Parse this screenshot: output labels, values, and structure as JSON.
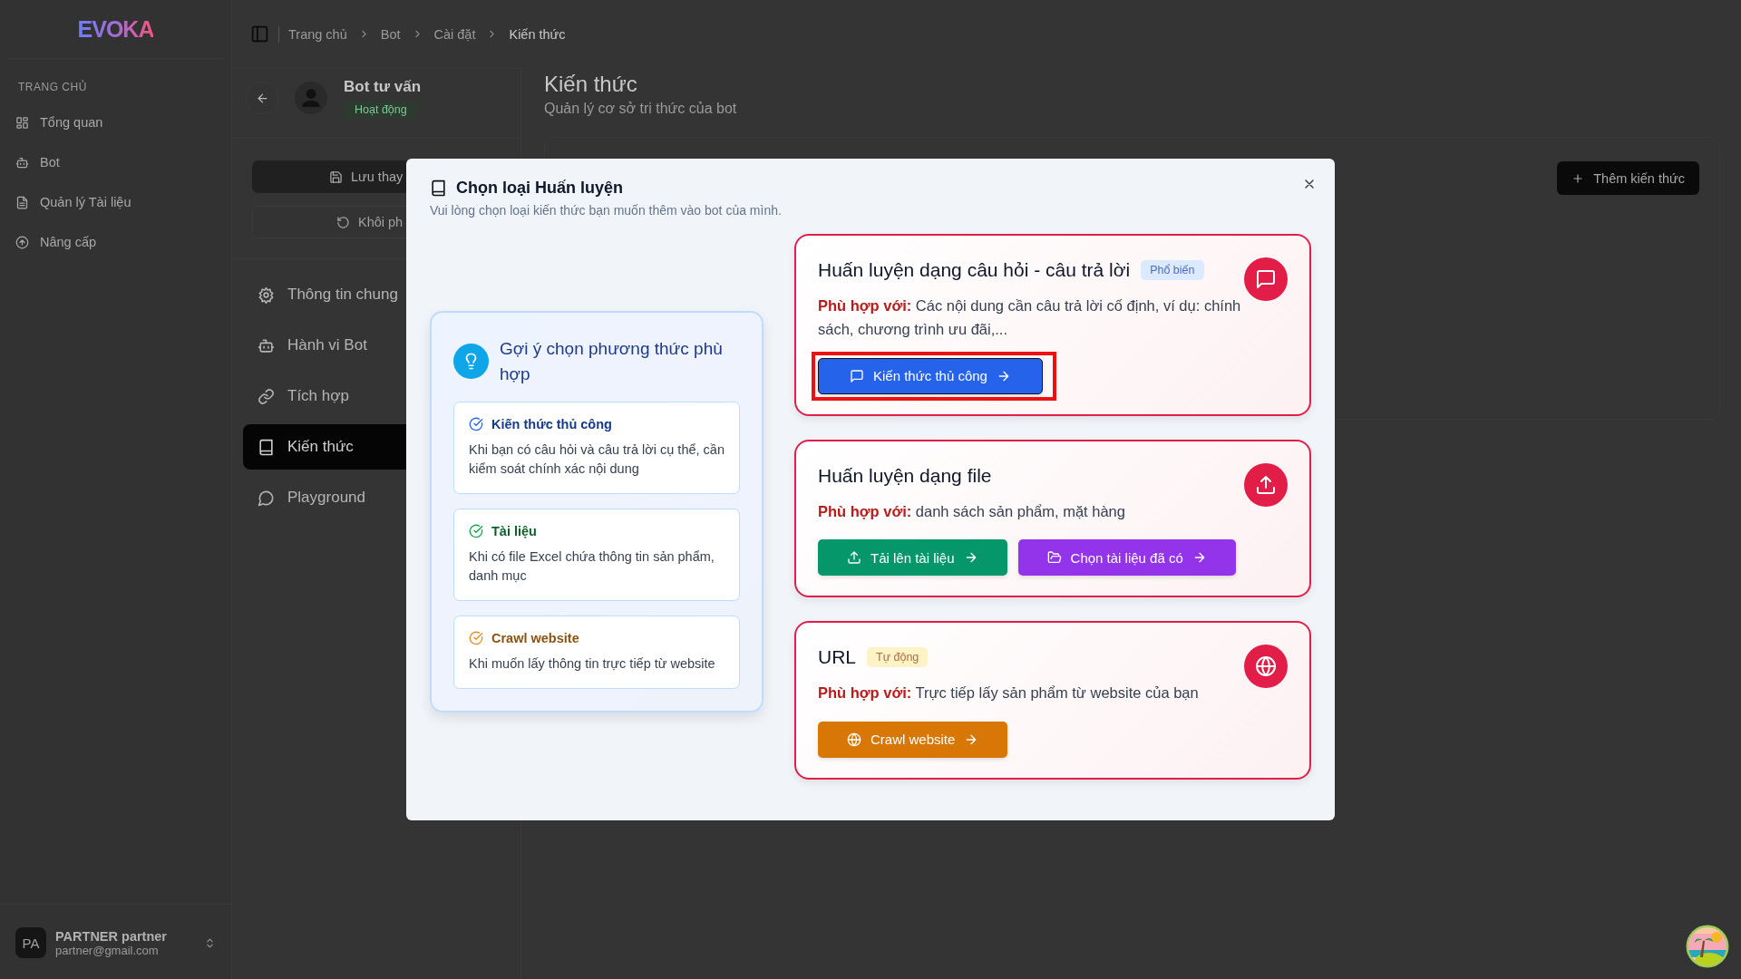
{
  "sidebar": {
    "logo": "EVOKA",
    "section": "TRANG CHỦ",
    "items": [
      {
        "label": "Tổng quan"
      },
      {
        "label": "Bot"
      },
      {
        "label": "Quản lý Tài liệu"
      },
      {
        "label": "Nâng cấp"
      }
    ],
    "user": {
      "initials": "PA",
      "name": "PARTNER partner",
      "email": "partner@gmail.com"
    }
  },
  "breadcrumb": [
    "Trang chủ",
    "Bot",
    "Cài đặt",
    "Kiến thức"
  ],
  "bot_panel": {
    "name": "Bot tư vấn",
    "status": "Hoạt động",
    "save_button": "Lưu thay",
    "restore_button": "Khôi ph",
    "menu": [
      {
        "label": "Thông tin chung",
        "selected": false
      },
      {
        "label": "Hành vi Bot",
        "selected": false
      },
      {
        "label": "Tích hợp",
        "selected": false
      },
      {
        "label": "Kiến thức",
        "selected": true
      },
      {
        "label": "Playground",
        "selected": false
      }
    ]
  },
  "main": {
    "title": "Kiến thức",
    "subtitle": "Quản lý cơ sở tri thức của bot",
    "add_button": "Thêm kiến thức"
  },
  "modal": {
    "title": "Chọn loại Huấn luyện",
    "subtitle": "Vui lòng chọn loại kiến thức bạn muốn thêm vào bot của mình.",
    "suggestion": {
      "title": "Gợi ý chọn phương thức phù hợp",
      "items": [
        {
          "title": "Kiến thức thủ công",
          "text": "Khi bạn có câu hỏi và câu trả lời cụ thể, cần kiểm soát chính xác nội dung",
          "color": "#2563eb"
        },
        {
          "title": "Tài liệu",
          "text": "Khi có file Excel chứa thông tin sản phẩm, danh mục",
          "color": "#16a34a"
        },
        {
          "title": "Crawl website",
          "text": "Khi muốn lấy thông tin trực tiếp từ website",
          "color": "#ea8a1a"
        }
      ]
    },
    "options": [
      {
        "title": "Huấn luyện dạng câu hỏi - câu trả lời",
        "badge": {
          "text": "Phổ biến",
          "color": "#dbeafe"
        },
        "fit_label": "Phù hợp với:",
        "fit_text": "Các nội dung cần câu trả lời cố định, ví dụ: chính sách, chương trình ưu đãi,...",
        "buttons": [
          {
            "label": "Kiến thức thủ công",
            "color": "#2563eb",
            "highlighted": true
          }
        ]
      },
      {
        "title": "Huấn luyện dạng file",
        "fit_label": "Phù hợp với:",
        "fit_text": "danh sách sản phẩm, mặt hàng",
        "buttons": [
          {
            "label": "Tải lên tài liệu",
            "color": "#059669",
            "highlighted": false
          },
          {
            "label": "Chọn tài liệu đã có",
            "color": "#9333ea",
            "highlighted": false
          }
        ]
      },
      {
        "title": "URL",
        "badge": {
          "text": "Tự động",
          "color": "#fef3c7"
        },
        "fit_label": "Phù hợp với:",
        "fit_text": "Trực tiếp lấy sản phẩm từ website của bạn",
        "buttons": [
          {
            "label": "Crawl website",
            "color": "#d97706",
            "highlighted": false
          }
        ]
      }
    ]
  }
}
